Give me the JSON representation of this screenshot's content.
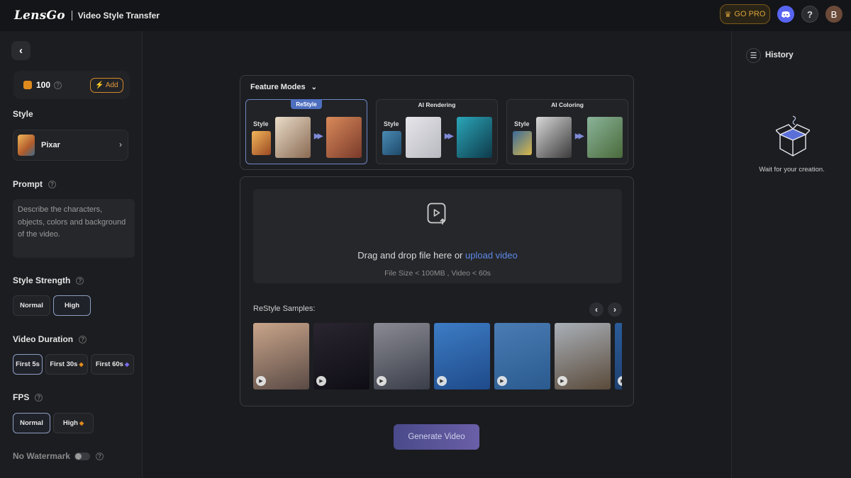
{
  "topbar": {
    "logo": "LensGo",
    "title": "Video Style Transfer",
    "gopro_label": "GO PRO",
    "avatar_letter": "B"
  },
  "sidebar": {
    "credits": "100",
    "add_label": "Add",
    "style_label": "Style",
    "style_value": "Pixar",
    "prompt_label": "Prompt",
    "prompt_placeholder": "Describe the characters, objects, colors and background of the video.",
    "strength_label": "Style Strength",
    "strength_options": [
      "Normal",
      "High"
    ],
    "strength_selected": "High",
    "duration_label": "Video Duration",
    "duration_options": [
      "First 5s",
      "First 30s",
      "First 60s"
    ],
    "duration_selected": "First 5s",
    "fps_label": "FPS",
    "fps_options": [
      "Normal",
      "High"
    ],
    "fps_selected": "Normal",
    "watermark_label": "No Watermark",
    "watermark_enabled": false
  },
  "features": {
    "header": "Feature Modes",
    "modes": [
      {
        "title": "ReStyle",
        "style_label": "Style",
        "selected": true
      },
      {
        "title": "AI Rendering",
        "style_label": "Style",
        "selected": false
      },
      {
        "title": "AI Coloring",
        "style_label": "Style",
        "selected": false
      }
    ]
  },
  "upload": {
    "drop_text": "Drag and drop file here or",
    "drop_link": "upload video",
    "limits": "File Size < 100MB , Video < 60s"
  },
  "samples": {
    "label": "ReStyle Samples:",
    "items": [
      {
        "name": "ballet",
        "colors": [
          "#c9a58a",
          "#5a4a45"
        ]
      },
      {
        "name": "sword",
        "colors": [
          "#2a2530",
          "#0e0d14"
        ]
      },
      {
        "name": "boxing",
        "colors": [
          "#8a8a94",
          "#3a3e48"
        ]
      },
      {
        "name": "girl-blue",
        "colors": [
          "#3d7cc4",
          "#1e4a8a"
        ]
      },
      {
        "name": "cookie-monster",
        "colors": [
          "#4a7cb4",
          "#2a5a8e"
        ]
      },
      {
        "name": "ship",
        "colors": [
          "#a9b0b8",
          "#5a4a3a"
        ]
      },
      {
        "name": "extra",
        "colors": [
          "#2a5c9a",
          "#1c3a66"
        ]
      }
    ]
  },
  "generate_label": "Generate Video",
  "history": {
    "label": "History",
    "empty_text": "Wait for your creation."
  },
  "colors": {
    "accent_blue": "#5d8ae8",
    "gold": "#d9a23a",
    "orange": "#e49a3a"
  }
}
